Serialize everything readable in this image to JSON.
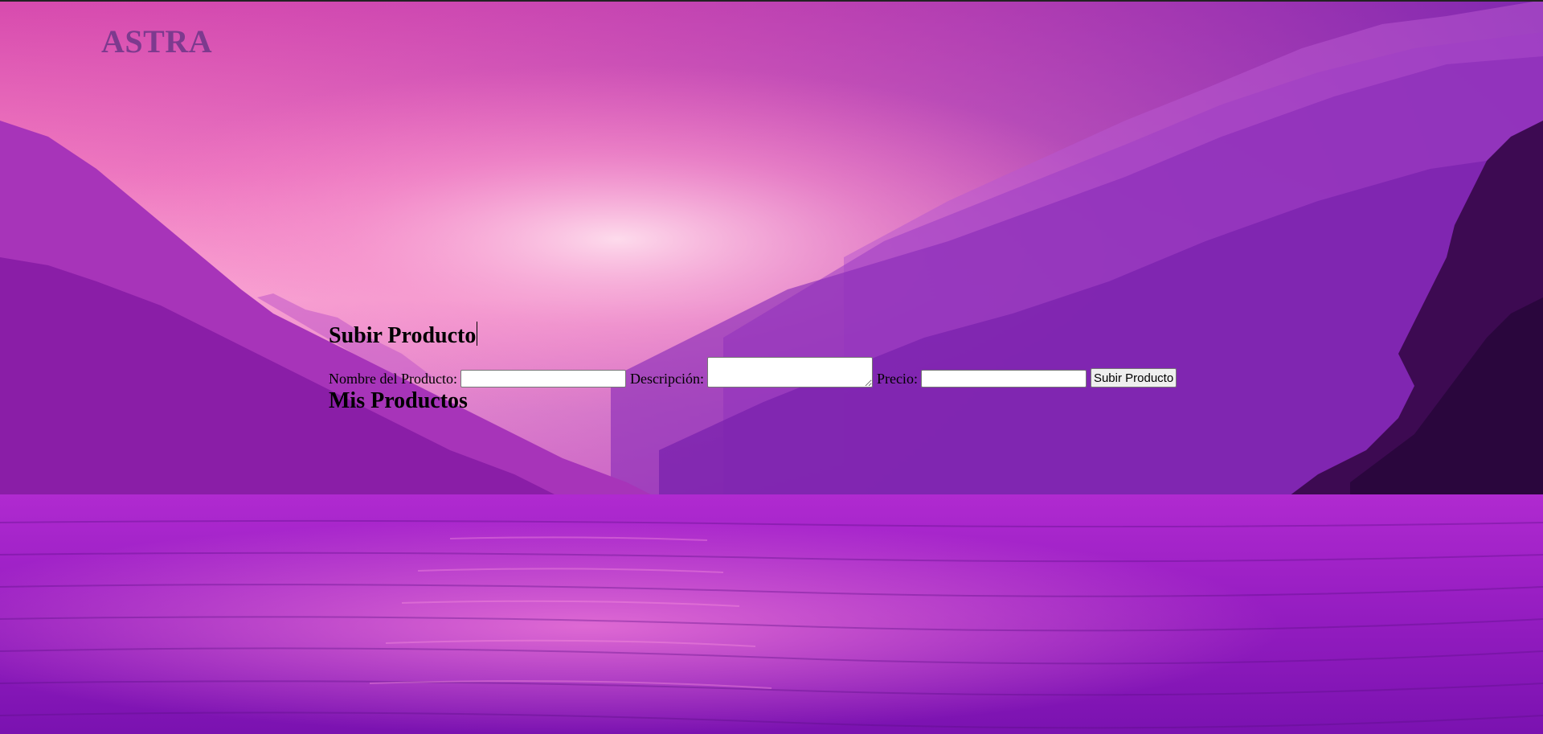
{
  "brand": {
    "name": "ASTRA"
  },
  "upload": {
    "heading": "Subir Producto",
    "name_label": "Nombre del Producto:",
    "name_value": "",
    "description_label": "Descripción:",
    "description_value": "",
    "price_label": "Precio:",
    "price_value": "",
    "submit_label": "Subir Producto"
  },
  "products": {
    "heading": "Mis Productos"
  },
  "colors": {
    "brand": "#7d3a8e",
    "sky_top": "#d94fb0",
    "sky_glow": "#ffc0dd",
    "water": "#9a1fc4",
    "mountains_dark": "#5a157e"
  }
}
